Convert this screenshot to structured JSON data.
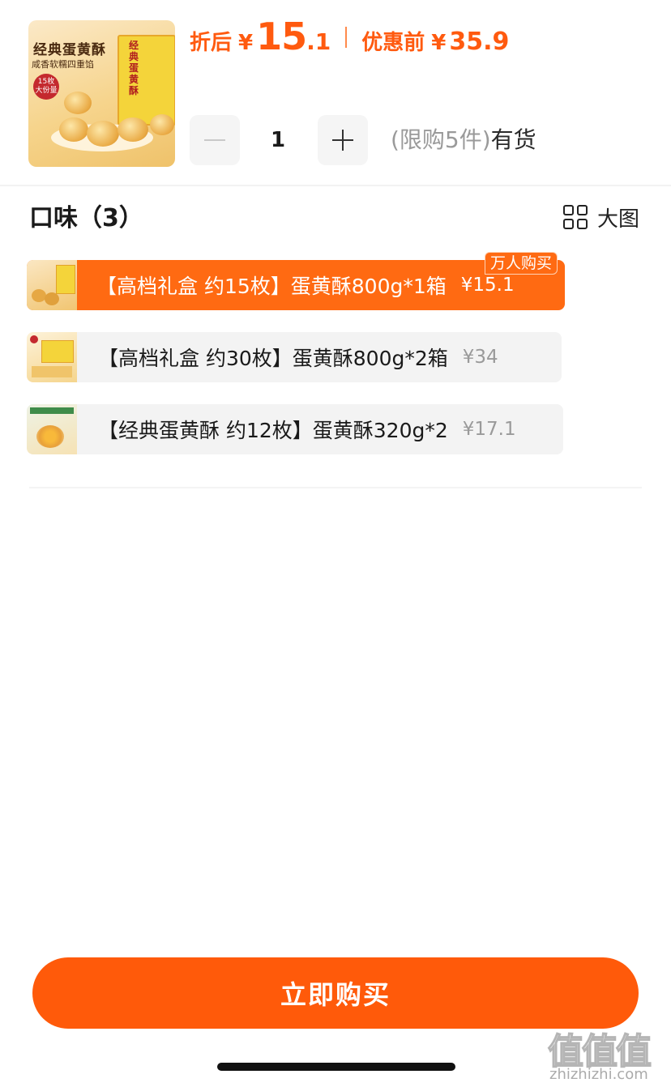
{
  "product": {
    "image_alt": "经典蛋黄酥 礼盒",
    "image_line1": "经典蛋黄酥",
    "image_line2": "咸香软糯四重馅",
    "image_badge_top": "15枚",
    "image_badge_bottom": "大份量",
    "image_box_text": "经典蛋黄酥"
  },
  "price": {
    "after_label": "折后",
    "currency": "¥",
    "after_int": "15",
    "after_dec": ".1",
    "before_label": "优惠前",
    "before_value": "35.9"
  },
  "quantity": {
    "value": "1",
    "limit_text": "(限购5件)",
    "stock_text": "有货"
  },
  "flavor": {
    "title": "口味（3）",
    "big_view_label": "大图",
    "options": [
      {
        "label": "【高档礼盒 约15枚】蛋黄酥800g*1箱",
        "price": "¥15.1",
        "selected": true,
        "tag": "万人购买"
      },
      {
        "label": "【高档礼盒 约30枚】蛋黄酥800g*2箱",
        "price": "¥34",
        "selected": false
      },
      {
        "label": "【经典蛋黄酥 约12枚】蛋黄酥320g*2",
        "price": "¥17.1",
        "selected": false
      }
    ]
  },
  "buy_button": "立即购买",
  "watermark": {
    "big": "值值值",
    "small": "zhizhizhi.com"
  },
  "colors": {
    "accent": "#ff5a0f",
    "chip_bg": "#f3f3f3",
    "selected_chip": "#ff6a12"
  }
}
